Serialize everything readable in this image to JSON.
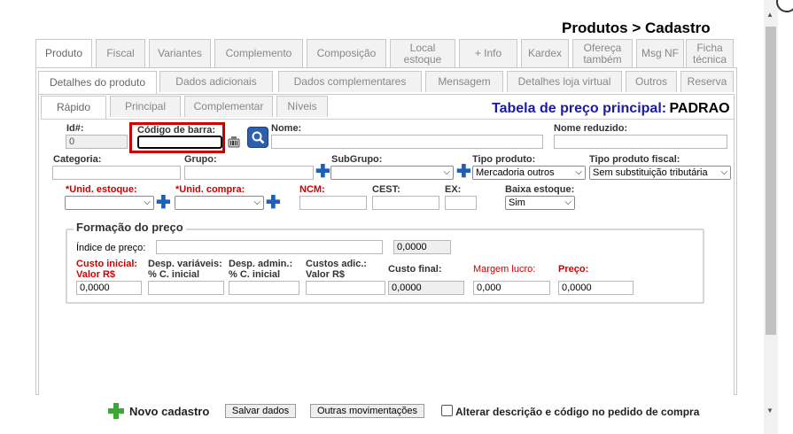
{
  "page_title": "Produtos > Cadastro",
  "main_tabs": [
    {
      "label": "Produto",
      "active": true
    },
    {
      "label": "Fiscal"
    },
    {
      "label": "Variantes"
    },
    {
      "label": "Complemento"
    },
    {
      "label": "Composição"
    },
    {
      "label": "Local estoque"
    },
    {
      "label": "+ Info"
    },
    {
      "label": "Kardex"
    },
    {
      "label": "Ofereça também"
    },
    {
      "label": "Msg NF"
    },
    {
      "label": "Ficha técnica"
    }
  ],
  "sub_tabs": [
    {
      "label": "Detalhes do produto",
      "active": true
    },
    {
      "label": "Dados adicionais"
    },
    {
      "label": "Dados complementares"
    },
    {
      "label": "Mensagem"
    },
    {
      "label": "Detalhes loja virtual"
    },
    {
      "label": "Outros"
    },
    {
      "label": "Reserva"
    }
  ],
  "inner_tabs": [
    {
      "label": "Rápido",
      "active": true
    },
    {
      "label": "Principal"
    },
    {
      "label": "Complementar"
    },
    {
      "label": "Níveis"
    }
  ],
  "price_table": {
    "label": "Tabela de preço principal:",
    "value": "PADRAO"
  },
  "fields": {
    "id_label": "Id#:",
    "id_value": "0",
    "barcode_label": "Código de barra:",
    "barcode_value": "",
    "nome_label": "Nome:",
    "nome_value": "",
    "nome_reduzido_label": "Nome reduzido:",
    "nome_reduzido_value": "",
    "categoria_label": "Categoria:",
    "categoria_value": "",
    "grupo_label": "Grupo:",
    "grupo_value": "",
    "subgrupo_label": "SubGrupo:",
    "subgrupo_value": "",
    "tipo_produto_label": "Tipo produto:",
    "tipo_produto_value": "Mercadoria outros",
    "tipo_fiscal_label": "Tipo produto fiscal:",
    "tipo_fiscal_value": "Sem substituição tributária",
    "unid_estoque_label": "*Unid. estoque:",
    "unid_estoque_value": "",
    "unid_compra_label": "*Unid. compra:",
    "unid_compra_value": "",
    "ncm_label": "NCM:",
    "ncm_value": "",
    "cest_label": "CEST:",
    "cest_value": "",
    "ex_label": "EX:",
    "ex_value": "",
    "baixa_estoque_label": "Baixa estoque:",
    "baixa_estoque_value": "Sim"
  },
  "pricing": {
    "legend": "Formação do preço",
    "indice_label": "Índice de preço:",
    "indice_value": "",
    "indice_result": "0,0000",
    "custo_inicial_label_1": "Custo inicial:",
    "custo_inicial_label_2": "Valor R$",
    "custo_inicial_value": "0,0000",
    "desp_var_label_1": "Desp. variáveis:",
    "desp_var_label_2": "% C. inicial",
    "desp_var_value": "",
    "desp_admin_label_1": "Desp. admin.:",
    "desp_admin_label_2": "% C. inicial",
    "desp_admin_value": "",
    "custos_adic_label_1": "Custos adic.:",
    "custos_adic_label_2": "Valor R$",
    "custos_adic_value": "",
    "custo_final_label": "Custo final:",
    "custo_final_value": "0,0000",
    "margem_label": "Margem lucro:",
    "margem_value": "0,000",
    "preco_label": "Preço:",
    "preco_value": "0,0000"
  },
  "footer": {
    "novo_cadastro": "Novo cadastro",
    "salvar": "Salvar dados",
    "outras": "Outras movimentações",
    "checkbox_label": "Alterar descrição e código no pedido de compra",
    "checkbox_checked": false
  },
  "colors": {
    "required_label": "#d00000",
    "highlight_border": "#cc0000",
    "price_title": "#1a1aa8",
    "plus_icon": "#1f5fb8",
    "novo_plus": "#3aa832"
  }
}
